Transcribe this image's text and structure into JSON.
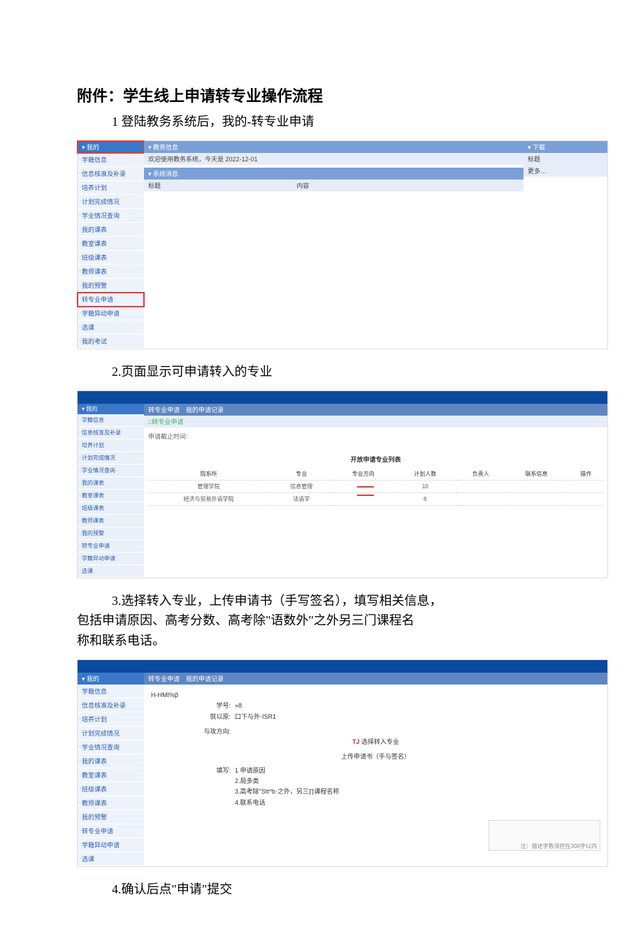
{
  "doc": {
    "title": "附件：学生线上申请转专业操作流程",
    "step1": "1 登陆教务系统后，我的-转专业申请",
    "step2": "2.页面显示可申请转入的专业",
    "step3_l1": "3.选择转入专业，上传申请书（手写签名），填写相关信息，",
    "step3_l2": "包括申请原因、高考分数、高考除\"语数外\"之外另三门课程名",
    "step3_l3": "称和联系电话。",
    "step4": "4.确认后点\"申请\"提交"
  },
  "sidebar": {
    "header": "▾ 我的",
    "items": [
      "学籍信息",
      "信息核准及补录",
      "培养计划",
      "计划完成情况",
      "学业情况查询",
      "我的课表",
      "教室课表",
      "班级课表",
      "教师课表",
      "我的预警",
      "转专业申请",
      "学籍异动申请",
      "选课",
      "我的考试"
    ],
    "hl_index_s1_header": true,
    "hl_index_s1_item": 10
  },
  "shot1": {
    "info_panel": "▾ 教务信息",
    "welcome": "欢迎使用教务系统，今天是 2022-12-01",
    "msg_panel": "▾ 系统消息",
    "col_title": "标题",
    "col_content": "内容",
    "dl_panel": "▾ 下载",
    "dl_label": "标题",
    "dl_more": "更多…"
  },
  "shot2": {
    "tabs": "转专业申请　我的申请记录",
    "subtab": "□转专业申请",
    "deadline_label": "申请截止时间:",
    "table_caption": "开放申请专业列表",
    "cols": [
      "院系所",
      "专业",
      "专业方向",
      "计划人数",
      "负责人",
      "联系信息",
      "操作"
    ],
    "rows": [
      {
        "dept": "管理学院",
        "major": "信息管理",
        "dir": "",
        "plan": "10",
        "owner": "",
        "contact": "",
        "op": ""
      },
      {
        "dept": "经济与贸易外语学院",
        "major": "法语学",
        "dir": "",
        "plan": "6",
        "owner": "",
        "contact": "",
        "op": ""
      }
    ]
  },
  "shot3": {
    "tabs": "转专业申请　我的申请记录",
    "line_student": "H-HMI%β",
    "label_id": "学号:",
    "val_id": "»8",
    "label_read": "就以原:",
    "val_read": "口下与外·ISR1",
    "label_dir": "与攻方向:",
    "tj_label": "TJ",
    "tj_text": " 选择转入专业",
    "upload_text": "上传申请书（手与签名）",
    "fill_label": "填写:",
    "fill_1": "1 申请原因",
    "fill_2": "2.局多类",
    "fill_3": "3.高考除\"Stt^b·之外，另三∏课程名称",
    "fill_4": "4.联系电话",
    "note": "注：描述字数须控在300字以内"
  }
}
